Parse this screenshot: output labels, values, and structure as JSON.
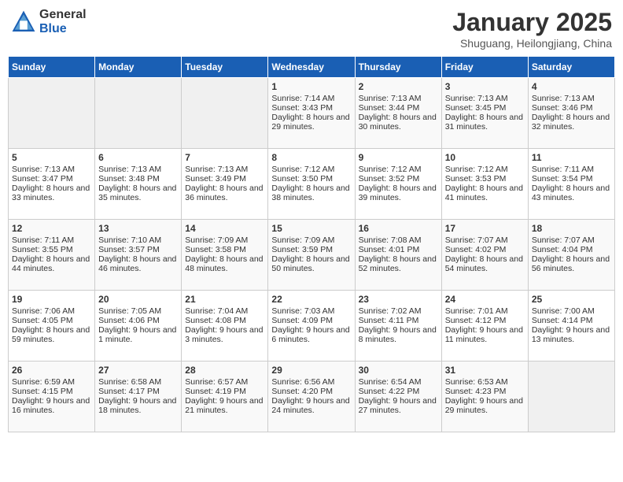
{
  "header": {
    "logo_general": "General",
    "logo_blue": "Blue",
    "title": "January 2025",
    "subtitle": "Shuguang, Heilongjiang, China"
  },
  "days_of_week": [
    "Sunday",
    "Monday",
    "Tuesday",
    "Wednesday",
    "Thursday",
    "Friday",
    "Saturday"
  ],
  "weeks": [
    {
      "days": [
        {
          "num": "",
          "content": ""
        },
        {
          "num": "",
          "content": ""
        },
        {
          "num": "",
          "content": ""
        },
        {
          "num": "1",
          "content": "Sunrise: 7:14 AM\nSunset: 3:43 PM\nDaylight: 8 hours and 29 minutes."
        },
        {
          "num": "2",
          "content": "Sunrise: 7:13 AM\nSunset: 3:44 PM\nDaylight: 8 hours and 30 minutes."
        },
        {
          "num": "3",
          "content": "Sunrise: 7:13 AM\nSunset: 3:45 PM\nDaylight: 8 hours and 31 minutes."
        },
        {
          "num": "4",
          "content": "Sunrise: 7:13 AM\nSunset: 3:46 PM\nDaylight: 8 hours and 32 minutes."
        }
      ]
    },
    {
      "days": [
        {
          "num": "5",
          "content": "Sunrise: 7:13 AM\nSunset: 3:47 PM\nDaylight: 8 hours and 33 minutes."
        },
        {
          "num": "6",
          "content": "Sunrise: 7:13 AM\nSunset: 3:48 PM\nDaylight: 8 hours and 35 minutes."
        },
        {
          "num": "7",
          "content": "Sunrise: 7:13 AM\nSunset: 3:49 PM\nDaylight: 8 hours and 36 minutes."
        },
        {
          "num": "8",
          "content": "Sunrise: 7:12 AM\nSunset: 3:50 PM\nDaylight: 8 hours and 38 minutes."
        },
        {
          "num": "9",
          "content": "Sunrise: 7:12 AM\nSunset: 3:52 PM\nDaylight: 8 hours and 39 minutes."
        },
        {
          "num": "10",
          "content": "Sunrise: 7:12 AM\nSunset: 3:53 PM\nDaylight: 8 hours and 41 minutes."
        },
        {
          "num": "11",
          "content": "Sunrise: 7:11 AM\nSunset: 3:54 PM\nDaylight: 8 hours and 43 minutes."
        }
      ]
    },
    {
      "days": [
        {
          "num": "12",
          "content": "Sunrise: 7:11 AM\nSunset: 3:55 PM\nDaylight: 8 hours and 44 minutes."
        },
        {
          "num": "13",
          "content": "Sunrise: 7:10 AM\nSunset: 3:57 PM\nDaylight: 8 hours and 46 minutes."
        },
        {
          "num": "14",
          "content": "Sunrise: 7:09 AM\nSunset: 3:58 PM\nDaylight: 8 hours and 48 minutes."
        },
        {
          "num": "15",
          "content": "Sunrise: 7:09 AM\nSunset: 3:59 PM\nDaylight: 8 hours and 50 minutes."
        },
        {
          "num": "16",
          "content": "Sunrise: 7:08 AM\nSunset: 4:01 PM\nDaylight: 8 hours and 52 minutes."
        },
        {
          "num": "17",
          "content": "Sunrise: 7:07 AM\nSunset: 4:02 PM\nDaylight: 8 hours and 54 minutes."
        },
        {
          "num": "18",
          "content": "Sunrise: 7:07 AM\nSunset: 4:04 PM\nDaylight: 8 hours and 56 minutes."
        }
      ]
    },
    {
      "days": [
        {
          "num": "19",
          "content": "Sunrise: 7:06 AM\nSunset: 4:05 PM\nDaylight: 8 hours and 59 minutes."
        },
        {
          "num": "20",
          "content": "Sunrise: 7:05 AM\nSunset: 4:06 PM\nDaylight: 9 hours and 1 minute."
        },
        {
          "num": "21",
          "content": "Sunrise: 7:04 AM\nSunset: 4:08 PM\nDaylight: 9 hours and 3 minutes."
        },
        {
          "num": "22",
          "content": "Sunrise: 7:03 AM\nSunset: 4:09 PM\nDaylight: 9 hours and 6 minutes."
        },
        {
          "num": "23",
          "content": "Sunrise: 7:02 AM\nSunset: 4:11 PM\nDaylight: 9 hours and 8 minutes."
        },
        {
          "num": "24",
          "content": "Sunrise: 7:01 AM\nSunset: 4:12 PM\nDaylight: 9 hours and 11 minutes."
        },
        {
          "num": "25",
          "content": "Sunrise: 7:00 AM\nSunset: 4:14 PM\nDaylight: 9 hours and 13 minutes."
        }
      ]
    },
    {
      "days": [
        {
          "num": "26",
          "content": "Sunrise: 6:59 AM\nSunset: 4:15 PM\nDaylight: 9 hours and 16 minutes."
        },
        {
          "num": "27",
          "content": "Sunrise: 6:58 AM\nSunset: 4:17 PM\nDaylight: 9 hours and 18 minutes."
        },
        {
          "num": "28",
          "content": "Sunrise: 6:57 AM\nSunset: 4:19 PM\nDaylight: 9 hours and 21 minutes."
        },
        {
          "num": "29",
          "content": "Sunrise: 6:56 AM\nSunset: 4:20 PM\nDaylight: 9 hours and 24 minutes."
        },
        {
          "num": "30",
          "content": "Sunrise: 6:54 AM\nSunset: 4:22 PM\nDaylight: 9 hours and 27 minutes."
        },
        {
          "num": "31",
          "content": "Sunrise: 6:53 AM\nSunset: 4:23 PM\nDaylight: 9 hours and 29 minutes."
        },
        {
          "num": "",
          "content": ""
        }
      ]
    }
  ]
}
